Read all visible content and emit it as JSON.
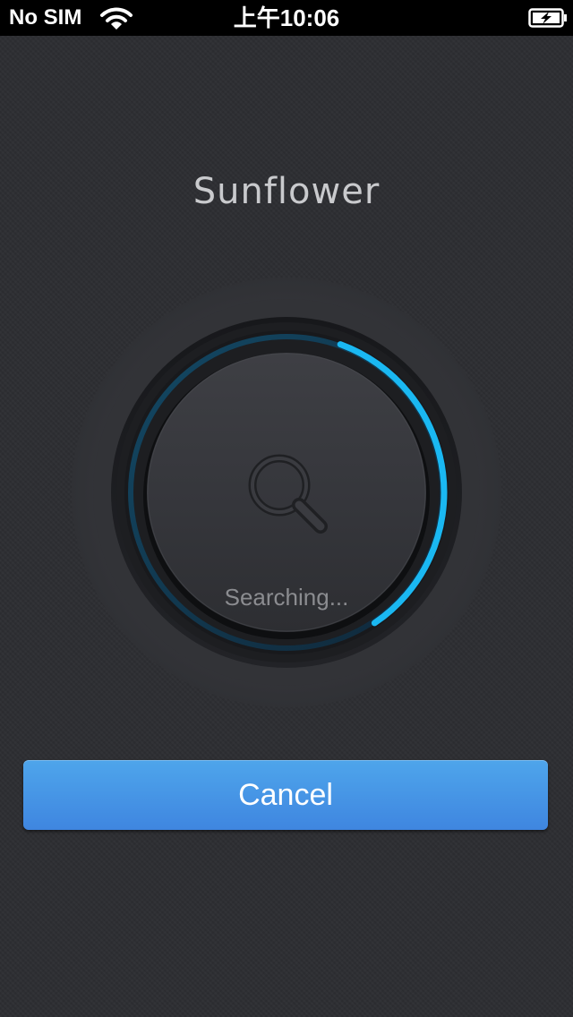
{
  "status_bar": {
    "carrier": "No SIM",
    "time": "上午10:06",
    "wifi_icon": "wifi-icon",
    "battery_icon": "battery-charging-icon"
  },
  "app": {
    "title": "Sunflower"
  },
  "search": {
    "status_text": "Searching...",
    "icon": "magnifier-icon",
    "progress_percent": 35,
    "accent_color": "#1ab8f2"
  },
  "actions": {
    "cancel_label": "Cancel",
    "button_color": "#4596e6"
  }
}
